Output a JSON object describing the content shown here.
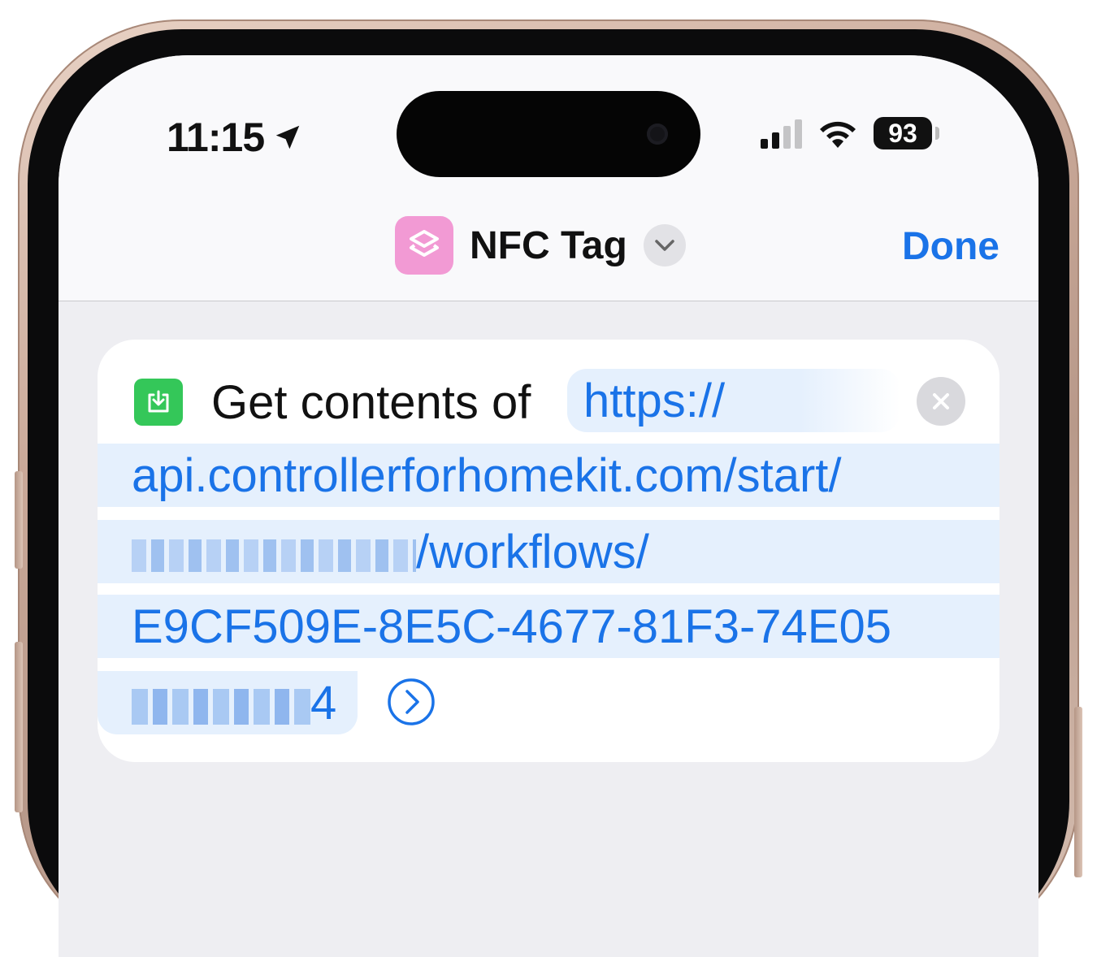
{
  "status_bar": {
    "time": "11:15",
    "battery": "93"
  },
  "nav": {
    "title": "NFC Tag",
    "done_label": "Done",
    "app_icon": "shortcuts-layers-icon",
    "menu_icon": "chevron-down-icon"
  },
  "action": {
    "icon": "download-box-icon",
    "label": "Get contents of",
    "url_lines": [
      "https://",
      "api.controllerforhomekit.com/start/",
      "/workflows/",
      "E9CF509E-8E5C-4677-81F3-74E05",
      "4"
    ],
    "clear_icon": "clear-x-icon",
    "go_icon": "chevron-right-circle-icon"
  },
  "colors": {
    "accent": "#1a73e8",
    "token_bg": "#e5f0fd",
    "app_icon_bg": "#f29ad4",
    "action_icon_bg": "#34c759"
  }
}
